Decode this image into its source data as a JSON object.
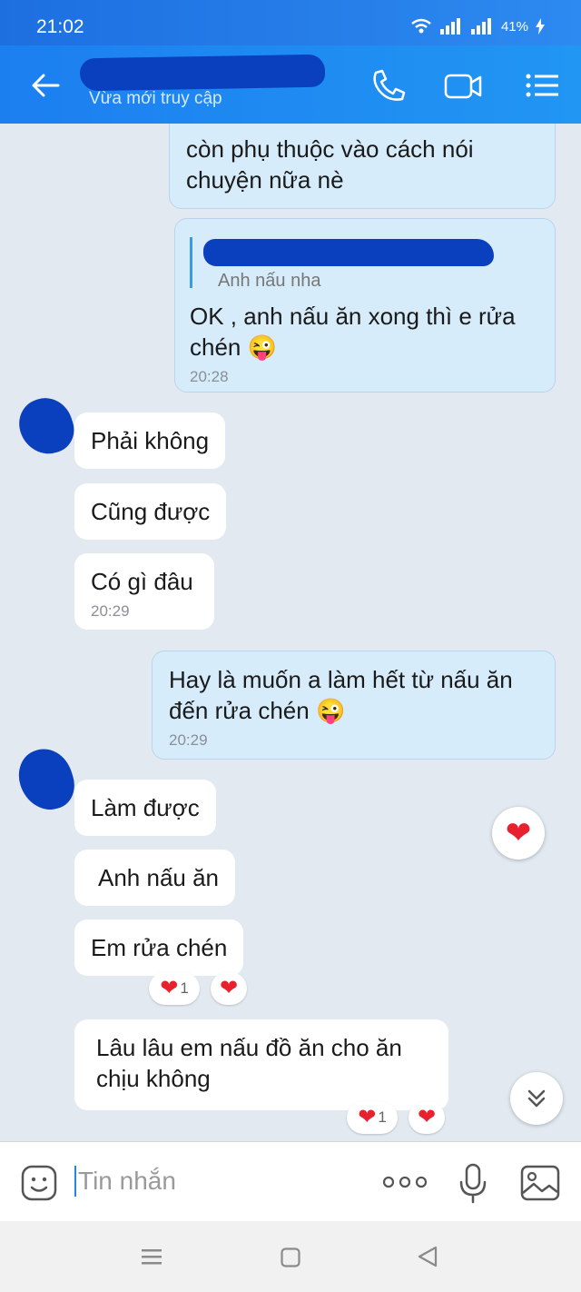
{
  "status_bar": {
    "time": "21:02",
    "battery": "41%"
  },
  "header": {
    "subtitle": "Vừa mới truy cập",
    "icons": [
      "back-arrow-icon",
      "phone-icon",
      "video-call-icon",
      "menu-list-icon"
    ]
  },
  "messages": [
    {
      "side": "me",
      "text": "còn phụ thuộc vào cách nói chuyện nữa nè"
    },
    {
      "side": "me",
      "quote": "Anh nấu nha",
      "text": "OK , anh nấu ăn xong thì e rửa chén 😜",
      "time": "20:28"
    },
    {
      "side": "them",
      "text": "Phải không"
    },
    {
      "side": "them",
      "text": "Cũng được"
    },
    {
      "side": "them",
      "text": "Có gì đâu",
      "time": "20:29"
    },
    {
      "side": "me",
      "text": "Hay là muốn a làm hết từ nấu ăn đến rửa chén 😜",
      "time": "20:29"
    },
    {
      "side": "them",
      "text": "Làm được"
    },
    {
      "side": "them",
      "text": "Anh nấu ăn"
    },
    {
      "side": "them",
      "text": "Em rửa chén",
      "reaction_count": "1"
    },
    {
      "side": "them",
      "text": "Lâu lâu em nấu đồ ăn cho ăn chịu không",
      "reaction_count": "1"
    }
  ],
  "input": {
    "placeholder": "Tin nhắn"
  },
  "colors": {
    "header": "#1e90ff",
    "my_bubble": "#d7ecfb",
    "their_bubble": "#ffffff",
    "chat_background": "#e2e9f1",
    "heart": "#e8212e"
  }
}
